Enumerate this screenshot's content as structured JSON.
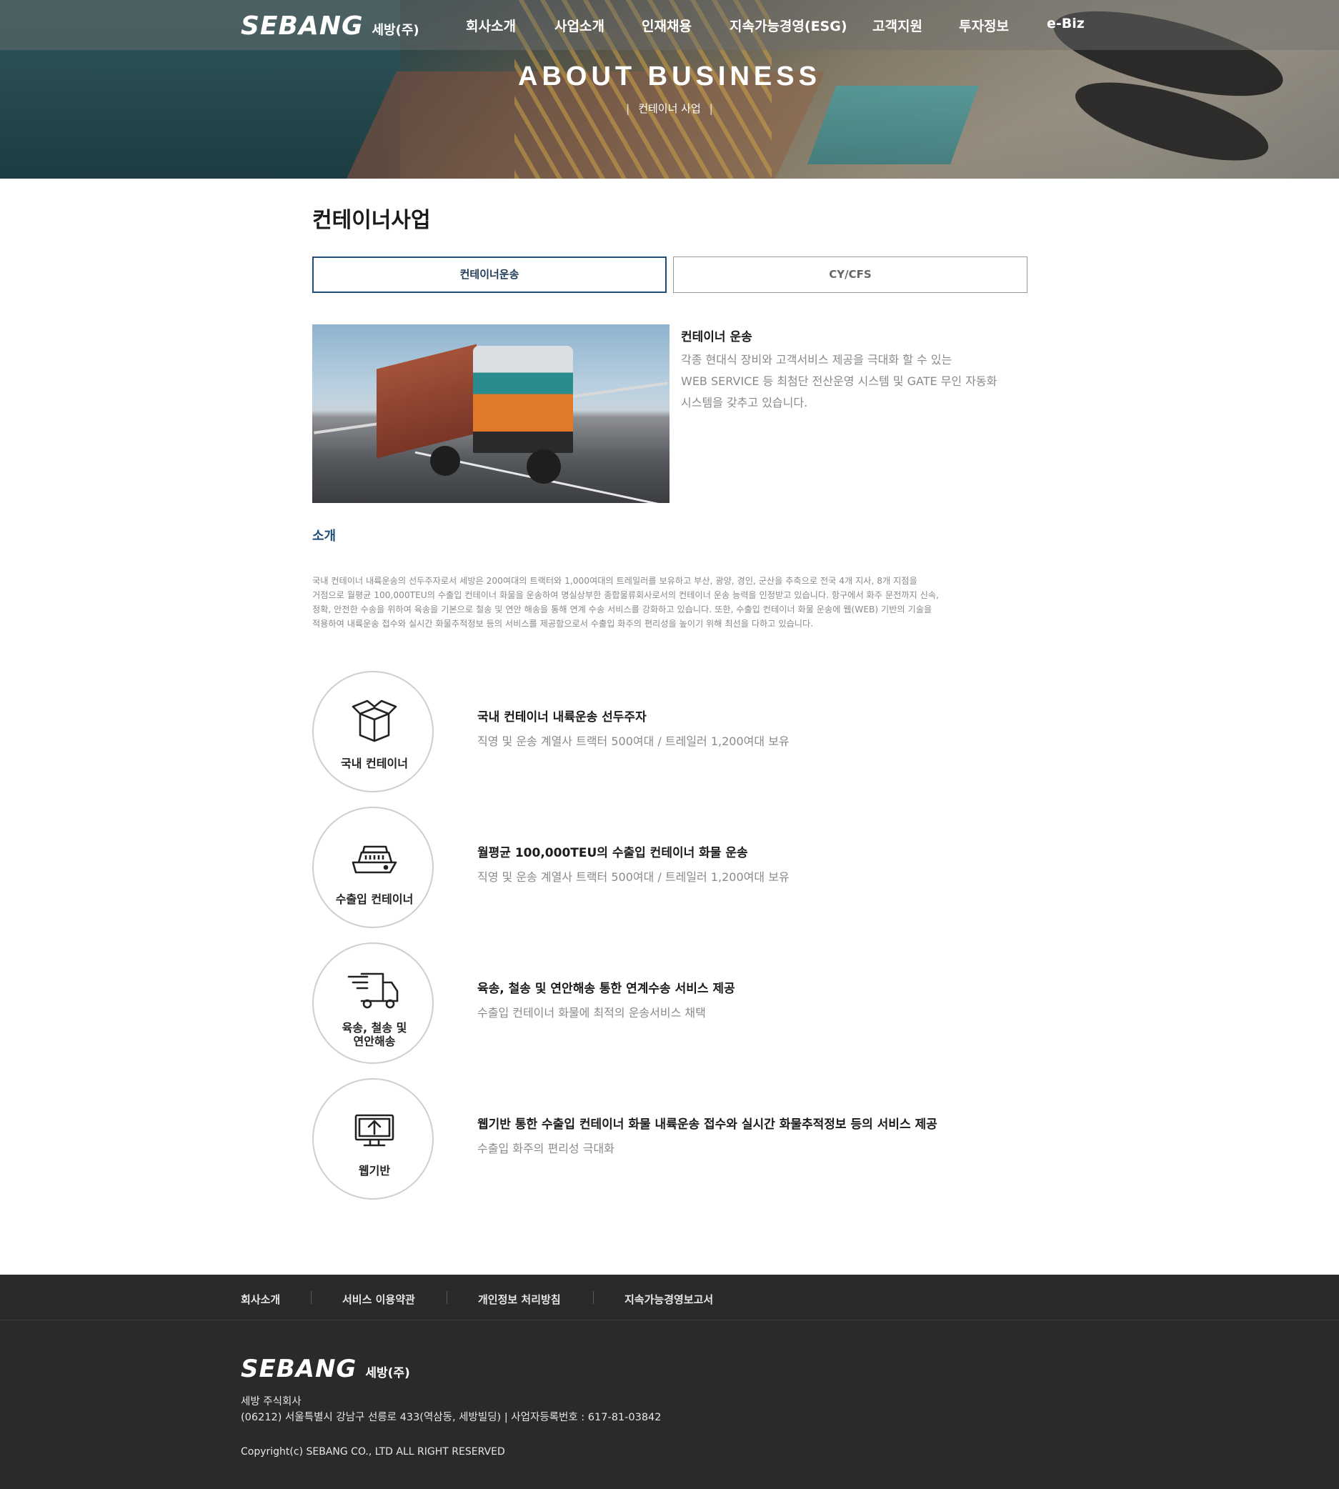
{
  "brand": {
    "logo_text": "SEBANG",
    "logo_sub": "세방(주)"
  },
  "nav": {
    "items": [
      "회사소개",
      "사업소개",
      "인재채용",
      "지속가능경영(ESG)",
      "고객지원",
      "투자정보",
      "e-Biz"
    ]
  },
  "hero": {
    "title": "ABOUT BUSINESS",
    "subtitle": "컨테이너 사업"
  },
  "main": {
    "page_title": "컨테이너사업",
    "tabs": [
      {
        "label": "컨테이너운송",
        "active": true
      },
      {
        "label": "CY/CFS",
        "active": false
      }
    ],
    "intro": {
      "heading": "컨테이너 운송",
      "lines": [
        "각종 현대식 장비와 고객서비스 제공을 극대화 할 수 있는",
        "WEB SERVICE 등 최첨단 전산운영 시스템 및 GATE 무인 자동화",
        "시스템을 갖추고 있습니다."
      ]
    },
    "section_heading": "소개",
    "section_lines": [
      "국내 컨테이너 내륙운송의 선두주자로서 세방은 200여대의 트랙터와 1,000여대의 트레일러를 보유하고 부산, 광양, 경인, 군산을 추축으로 전국 4개 지사, 8개 지점을",
      "거점으로 월평균 100,000TEU의 수출입 컨테이너 화물을 운송하여 명실상부한 종합물류회사로서의 컨테이너 운송 능력을 인정받고 있습니다. 항구에서 화주 문전까지 신속,",
      "정확, 안전한 수송을 위하여 육송을 기본으로 철송 및 연안 해송을 통해 연계 수송 서비스를 강화하고 있습니다. 또한, 수출입 컨테이너 화물 운송에 웹(WEB) 기반의 기술을",
      "적용하여 내륙운송 접수와 실시간 화물추적정보 등의 서비스를 제공함으로서 수출입 화주의 편리성을 높이기 위해 최선을 다하고 있습니다."
    ],
    "features": [
      {
        "icon": "box-icon",
        "label_lines": [
          "국내 컨테이너"
        ],
        "title": "국내 컨테이너 내륙운송 선두주자",
        "desc": "직영 및 운송 계열사 트랙터 500여대 / 트레일러 1,200여대 보유"
      },
      {
        "icon": "ship-icon",
        "label_lines": [
          "수출입 컨테이너"
        ],
        "title": "월평균 100,000TEU의 수출입 컨테이너 화물 운송",
        "desc": "직영 및 운송 계열사 트랙터 500여대 / 트레일러 1,200여대 보유"
      },
      {
        "icon": "truck-icon",
        "label_lines": [
          "육송, 철송 및",
          "연안해송"
        ],
        "title": "육송, 철송 및 연안해송 통한 연계수송 서비스 제공",
        "desc": "수출입 컨테이너 화물에 최적의 운송서비스 채택"
      },
      {
        "icon": "monitor-upload-icon",
        "label_lines": [
          "웹기반"
        ],
        "title": "웹기반 통한 수출입 컨테이너 화물 내륙운송 접수와 실시간 화물추적정보 등의 서비스 제공",
        "desc": "수출입 화주의 편리성 극대화"
      }
    ]
  },
  "footer": {
    "links": [
      "회사소개",
      "서비스 이용약관",
      "개인정보 처리방침",
      "지속가능경영보고서"
    ],
    "company": "세방 주식회사",
    "address": "(06212) 서울특별시 강남구 선릉로 433(역삼동, 세방빌딩) | 사업자등록번호 : 617-81-03842",
    "copyright": "Copyright(c) SEBANG CO., LTD ALL RIGHT RESERVED"
  },
  "colors": {
    "accent": "#1f4e79",
    "footer_bg": "#2a2a2a",
    "muted_text": "#8a8a8a"
  }
}
